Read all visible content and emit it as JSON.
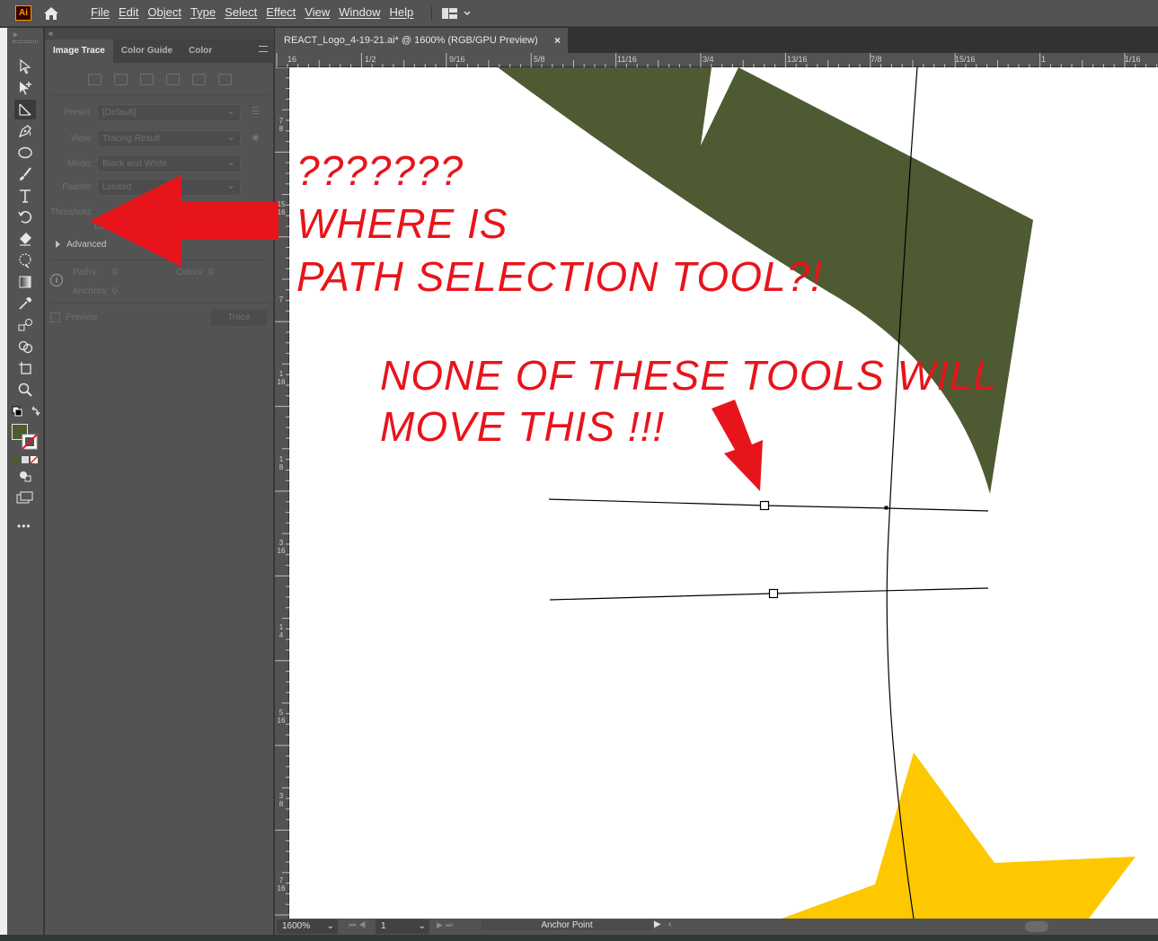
{
  "app": {
    "logo_text": "Ai",
    "accent_color": "#ff9a00"
  },
  "menu": [
    "File",
    "Edit",
    "Object",
    "Type",
    "Select",
    "Effect",
    "View",
    "Window",
    "Help"
  ],
  "toolbar": {
    "collapse_label": "»",
    "tools": [
      "selection-tool",
      "direct-selection-tool",
      "line-segment-tool",
      "pen-tool",
      "ellipse-tool",
      "paintbrush-tool",
      "type-tool",
      "rotate-tool",
      "eraser-tool",
      "puppet-warp-tool",
      "gradient-tool",
      "eyedropper-tool",
      "blend-tool",
      "shape-builder-tool",
      "artboard-tool",
      "zoom-tool"
    ],
    "fill_color": "#4e5a32",
    "edit_toolbar_label": "•••"
  },
  "panel": {
    "collapse_label": "«",
    "tabs": [
      "Image Trace",
      "Color Guide",
      "Color"
    ],
    "preset_label": "Preset:",
    "preset_value": "[Default]",
    "view_label": "View:",
    "view_value": "Tracing Result",
    "mode_label": "Mode:",
    "mode_value": "Black and White",
    "palette_label": "Palette:",
    "palette_value": "Limited",
    "threshold_label": "Threshold:",
    "threshold_value": "128",
    "advanced_label": "Advanced",
    "paths_label": "Paths:",
    "paths_value": "0",
    "colors_label": "Colors:",
    "colors_value": "0",
    "anchors_label": "Anchors:",
    "anchors_value": "0",
    "preview_label": "Preview",
    "trace_label": "Trace"
  },
  "document": {
    "tab_title": "REACT_Logo_4-19-21.ai* @ 1600% (RGB/GPU Preview)",
    "close_glyph": "×",
    "hruler_labels": [
      "16",
      "1/2",
      "9/16",
      "5/8",
      "11/16",
      "3/4",
      "13/16",
      "7/8",
      "15/16",
      "1",
      "1/16"
    ],
    "vruler_labels": [
      "7\n8",
      "15\n16",
      "7",
      "1\n16",
      "1\n8",
      "3\n16",
      "1\n4",
      "5\n16",
      "3\n8",
      "7\n16"
    ]
  },
  "annotations": {
    "line1": "???????",
    "line2": "WHERE IS",
    "line3": "PATH SELECTION TOOL?!",
    "line4": "NONE OF THESE TOOLS WILL",
    "line5": "MOVE THIS !!!",
    "color": "#e8141c"
  },
  "artwork_colors": {
    "olive": "#4e5a32",
    "yellow": "#fdc800"
  },
  "status": {
    "zoom": "1600%",
    "artboard": "1",
    "info": "Anchor Point"
  }
}
